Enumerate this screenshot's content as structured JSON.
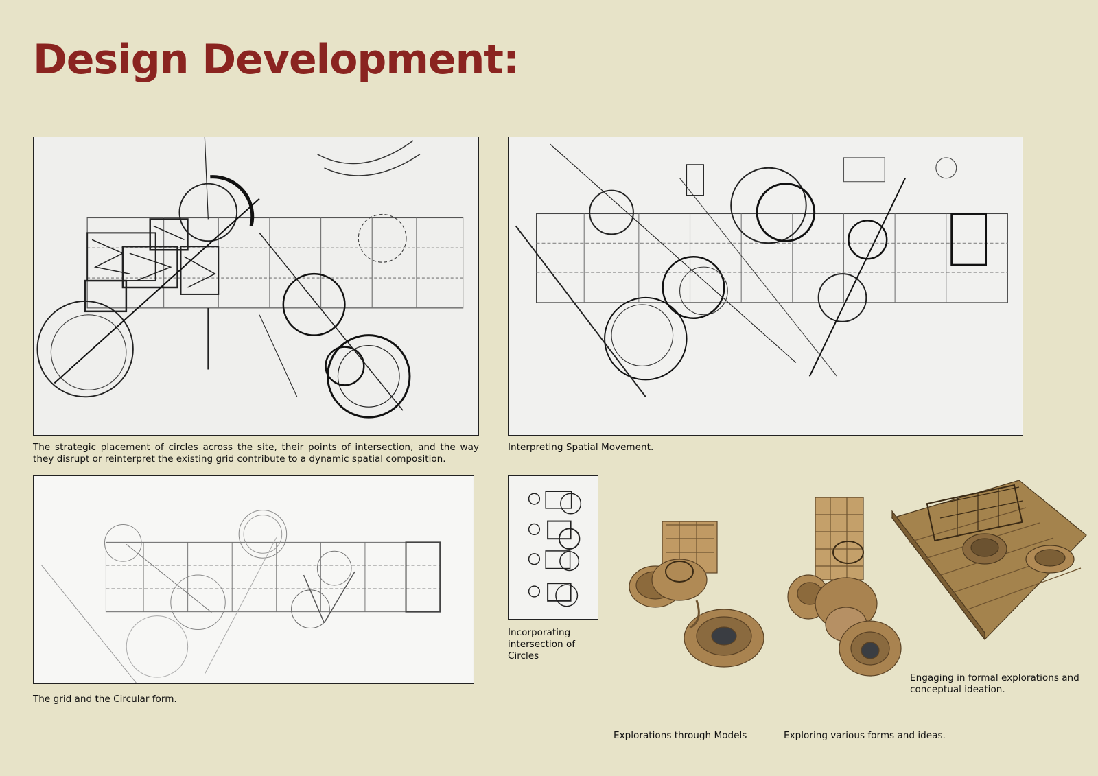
{
  "page": {
    "title": "Design Development:"
  },
  "panels": {
    "sketch1": {
      "caption": "The strategic placement of circles across the site, their points of intersection, and the way they disrupt or reinterpret the existing grid contribute to a dynamic spatial composition."
    },
    "sketch2": {
      "caption": "Interpreting Spatial Movement."
    },
    "sketch3": {
      "caption": "The grid and the Circular form."
    },
    "sketch4": {
      "caption": "Incorporating intersection of Circles"
    }
  },
  "models": {
    "caption_models": "Explorations through Models",
    "caption_forms": "Exploring various forms and ideas.",
    "caption_formal": "Engaging in formal explorations and conceptual ideation."
  },
  "colors": {
    "background": "#e7e3c8",
    "title": "#8a2420",
    "cardboard": "#b08a55",
    "cardboard_dark": "#6e5330"
  }
}
